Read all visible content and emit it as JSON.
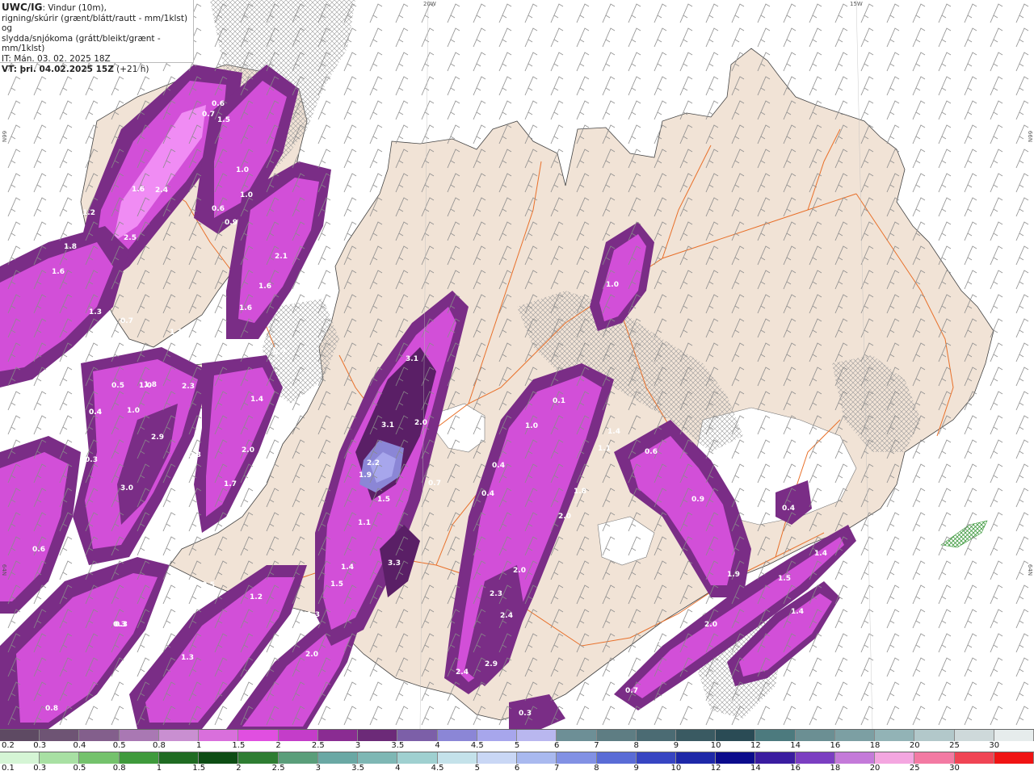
{
  "header": {
    "model": "UWC/IG",
    "desc1": ": Vindur (10m),",
    "desc2": "rigning/skúrir (grænt/blátt/rautt - mm/1klst) og",
    "desc3": "slydda/snjókoma (grátt/bleikt/grænt - mm/1klst)",
    "init": "IT: Mán. 03. 02. 2025 18Z",
    "valid": "VT: þri. 04.02.2025 15Z",
    "lead": "(+21 h)"
  },
  "grid_labels": {
    "lon_20w": "20W",
    "lon_15w": "15W",
    "lat_66n_left": "66N",
    "lat_66n_right": "66N",
    "lat_64n_left": "64N",
    "lat_64n_right": "64N"
  },
  "colors": {
    "land": "#f1e3d6",
    "road": "#e8702a",
    "sea": "#ffffff",
    "precip_light": "#f08cf4",
    "precip_mid": "#d24fd8",
    "precip_dark": "#7a2d86",
    "precip_core": "#8b86d6"
  },
  "precip_values": [
    "0.6",
    "0.7",
    "1.5",
    "1.0",
    "1.6",
    "2.4",
    "1.0",
    "0.6",
    "0.9",
    "1.2",
    "2.5",
    "1.8",
    "1.6",
    "2.1",
    "1.6",
    "1.3",
    "1.6",
    "0.7",
    "1.1",
    "0.7",
    "1.0",
    "0.4",
    "1.8",
    "2.3",
    "0.5",
    "0.4",
    "1.0",
    "2.9",
    "0.3",
    "3.0",
    "0.3",
    "2.0",
    "1.4",
    "0.7",
    "1.7",
    "0.6",
    "3.1",
    "3.1",
    "2.0",
    "1.3",
    "2.2",
    "1.9",
    "0.7",
    "1.5",
    "1.1",
    "3.3",
    "1.4",
    "1.5",
    "0.5",
    "1.2",
    "1.3",
    "0.3",
    "2.0",
    "1.3",
    "1.0",
    "0.8",
    "0.1",
    "1.0",
    "1.4",
    "1.1",
    "0.4",
    "1.8",
    "0.6",
    "0.4",
    "2.0",
    "0.9",
    "0.4",
    "2.0",
    "2.3",
    "2.4",
    "1.9",
    "1.5",
    "1.4",
    "1.4",
    "2.0",
    "2.4",
    "2.9",
    "1.5",
    "0.7",
    "0.3",
    "0.3"
  ],
  "legend_snow": [
    "0.2",
    "0.3",
    "0.4",
    "0.5",
    "0.8",
    "1",
    "1.5",
    "2",
    "2.5",
    "3",
    "3.5",
    "4",
    "4.5",
    "5",
    "6",
    "7",
    "8",
    "9",
    "10",
    "12",
    "14",
    "16",
    "18",
    "20",
    "25",
    "30"
  ],
  "legend_rain": [
    "0.1",
    "0.3",
    "0.5",
    "0.8",
    "1",
    "1.5",
    "2",
    "2.5",
    "3",
    "3.5",
    "4",
    "4.5",
    "5",
    "6",
    "7",
    "8",
    "9",
    "10",
    "12",
    "14",
    "16",
    "18",
    "20",
    "25",
    "30"
  ],
  "legend_snow_colors": [
    "#5e4a63",
    "#6e5474",
    "#835f8c",
    "#a978b3",
    "#c98fd1",
    "#d96fdc",
    "#e04fe0",
    "#c43dc9",
    "#8a2c92",
    "#6c2a78",
    "#7c5fa8",
    "#8b86d6",
    "#a7a6ec",
    "#b9b7ef",
    "#6d8f96",
    "#5e7d83",
    "#4b6b73",
    "#3a5a62",
    "#2a4b55",
    "#4c7a7e",
    "#6b8f93",
    "#7c9fa3",
    "#92b3b6",
    "#b2c8ca",
    "#ced9da",
    "#e6ecec"
  ],
  "legend_rain_colors": [
    "#d5f5d5",
    "#a8e0a3",
    "#74c26c",
    "#3f9a3c",
    "#1f6b22",
    "#0d4d14",
    "#2e7d32",
    "#5a9e7a",
    "#6aa8a4",
    "#7eb7b4",
    "#9fd0d0",
    "#c4e2ea",
    "#c9d7f5",
    "#a9b9ef",
    "#8291e4",
    "#5a6cd6",
    "#3745c2",
    "#1e28a8",
    "#0b0b8c",
    "#3a1ca0",
    "#7b3ec1",
    "#c47ad9",
    "#f4a6e0",
    "#f37aa3",
    "#f04454",
    "#f01414"
  ]
}
